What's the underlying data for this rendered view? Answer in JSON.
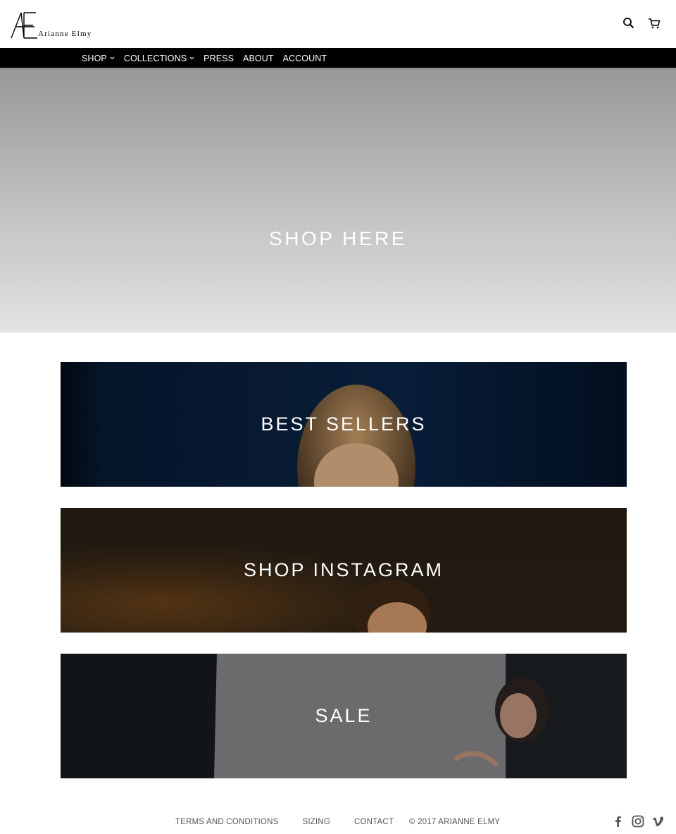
{
  "brand": {
    "logo_text": "Arianne Elmy",
    "logo_icon": "ae-monogram-logo"
  },
  "header": {
    "search_icon": "search-icon",
    "cart_icon": "cart-icon"
  },
  "nav": {
    "items": [
      {
        "label": "SHOP",
        "has_dropdown": true
      },
      {
        "label": "COLLECTIONS",
        "has_dropdown": true
      },
      {
        "label": "PRESS",
        "has_dropdown": false
      },
      {
        "label": "ABOUT",
        "has_dropdown": false
      },
      {
        "label": "ACCOUNT",
        "has_dropdown": false
      }
    ]
  },
  "hero": {
    "title": "SHOP HERE"
  },
  "promos": [
    {
      "title": "BEST SELLERS"
    },
    {
      "title": "SHOP INSTAGRAM"
    },
    {
      "title": "SALE"
    }
  ],
  "footer": {
    "links": [
      "TERMS AND CONDITIONS",
      "SIZING",
      "CONTACT"
    ],
    "copyright": "© 2017 ARIANNE ELMY",
    "social": [
      "facebook-icon",
      "instagram-icon",
      "vimeo-icon"
    ]
  },
  "colors": {
    "nav_bg": "#000000",
    "text_light": "#ffffff",
    "footer_text": "#555555"
  }
}
